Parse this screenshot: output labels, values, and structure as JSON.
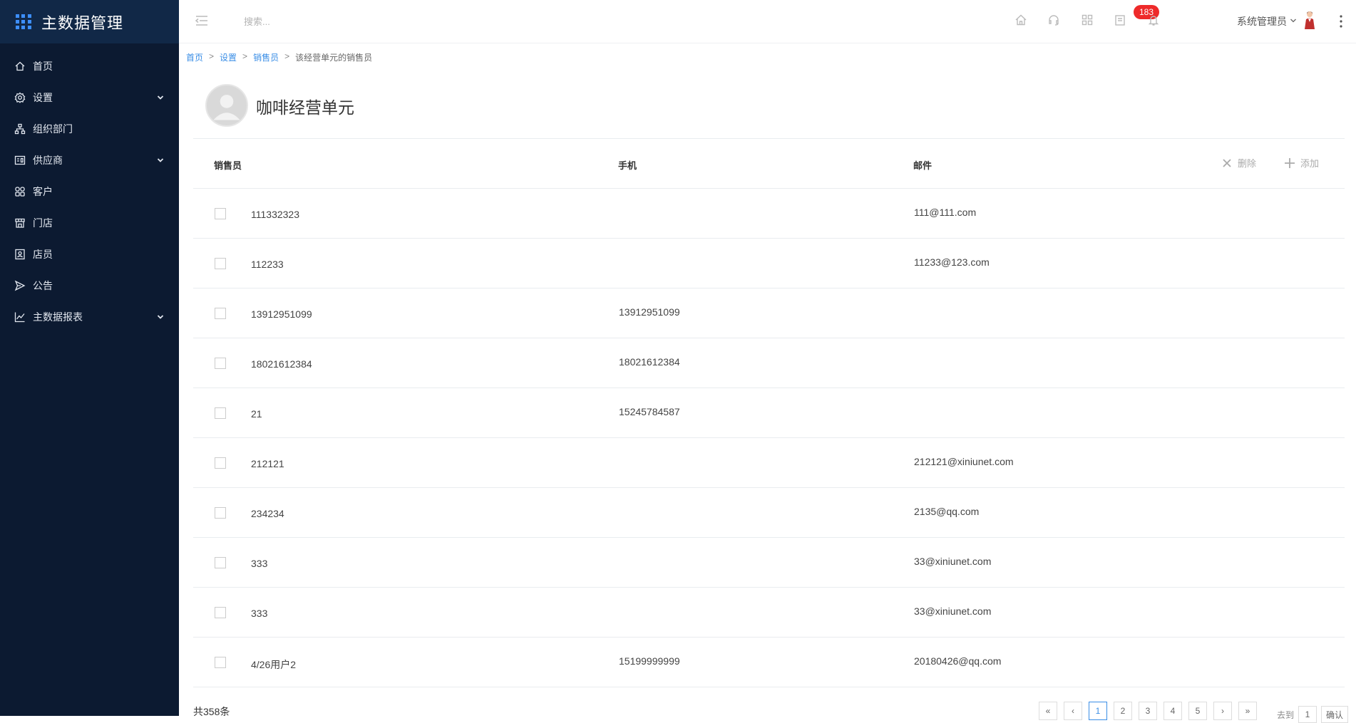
{
  "app": {
    "title": "主数据管理"
  },
  "sidebar": {
    "items": [
      {
        "label": "首页",
        "icon": "home-icon",
        "expandable": false
      },
      {
        "label": "设置",
        "icon": "gear-icon",
        "expandable": true
      },
      {
        "label": "组织部门",
        "icon": "org-chart-icon",
        "expandable": false
      },
      {
        "label": "供应商",
        "icon": "supplier-icon",
        "expandable": true
      },
      {
        "label": "客户",
        "icon": "customer-icon",
        "expandable": false
      },
      {
        "label": "门店",
        "icon": "store-icon",
        "expandable": false
      },
      {
        "label": "店员",
        "icon": "clerk-icon",
        "expandable": false
      },
      {
        "label": "公告",
        "icon": "announcement-icon",
        "expandable": false
      },
      {
        "label": "主数据报表",
        "icon": "chart-line-icon",
        "expandable": true
      }
    ]
  },
  "topbar": {
    "search_placeholder": "搜索...",
    "notification_count": "183",
    "user_name": "系统管理员"
  },
  "breadcrumb": {
    "home": "首页",
    "settings": "设置",
    "sales": "销售员",
    "current": "该经营单元的销售员",
    "separator": ">"
  },
  "unit": {
    "title": "咖啡经营单元"
  },
  "table": {
    "headers": {
      "name": "销售员",
      "phone": "手机",
      "email": "邮件"
    },
    "actions": {
      "delete": "删除",
      "add": "添加"
    },
    "rows": [
      {
        "name": "111332323",
        "phone": "",
        "email": "111@111.com"
      },
      {
        "name": "112233",
        "phone": "",
        "email": "11233@123.com"
      },
      {
        "name": "13912951099",
        "phone": "13912951099",
        "email": ""
      },
      {
        "name": "18021612384",
        "phone": "18021612384",
        "email": ""
      },
      {
        "name": "21",
        "phone": "15245784587",
        "email": ""
      },
      {
        "name": "212121",
        "phone": "",
        "email": "212121@xiniunet.com"
      },
      {
        "name": "234234",
        "phone": "",
        "email": "2135@qq.com"
      },
      {
        "name": "333",
        "phone": "",
        "email": "33@xiniunet.com"
      },
      {
        "name": "333",
        "phone": "",
        "email": "33@xiniunet.com"
      },
      {
        "name": "4/26用户2",
        "phone": "15199999999",
        "email": "20180426@qq.com"
      }
    ]
  },
  "pagination": {
    "total_text": "共358条",
    "first": "«",
    "prev": "‹",
    "pages": [
      "1",
      "2",
      "3",
      "4",
      "5"
    ],
    "current_page": "1",
    "next": "›",
    "last": "»",
    "goto_label": "去到",
    "goto_value": "1",
    "confirm": "确认"
  },
  "colors": {
    "sidebar_bg": "#0c1a31",
    "brand_bg": "#112847",
    "accent": "#3a8ee6",
    "badge": "#ee2a2a"
  }
}
